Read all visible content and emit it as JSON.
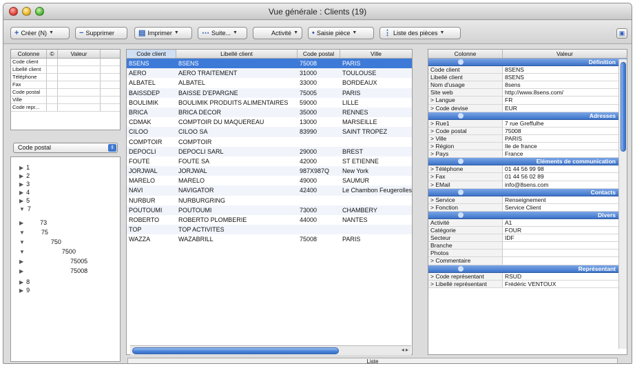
{
  "window": {
    "title": "Vue générale : Clients  (19)"
  },
  "toolbar": {
    "create": "Créer (N)",
    "delete": "Supprimer",
    "print": "Imprimer",
    "more": "Suite...",
    "activity": "Activité",
    "entry": "Saisie pièce",
    "list": "Liste des pièces"
  },
  "field_list": {
    "headers": [
      "Colonne",
      "©",
      "Valeur"
    ],
    "rows": [
      "Code client",
      "Libellé client",
      "Téléphone",
      "Fax",
      "Code postal",
      "Ville",
      "Code repr..."
    ]
  },
  "group_select": {
    "value": "Code postal"
  },
  "tree": [
    "1",
    "2",
    "3",
    "4",
    "5",
    "7",
    "73",
    "75",
    "750",
    "7500",
    "75005",
    "75008",
    "8",
    "9"
  ],
  "clients": {
    "headers": [
      "Code client",
      "Libellé client",
      "Code postal",
      "Ville"
    ],
    "rows": [
      [
        "8SENS",
        "8SENS",
        "75008",
        "PARIS"
      ],
      [
        "AERO",
        "AERO TRAITEMENT",
        "31000",
        "TOULOUSE"
      ],
      [
        "ALBATEL",
        "ALBATEL",
        "33000",
        "BORDEAUX"
      ],
      [
        "BAISSDEP",
        "BAISSE D'EPARGNE",
        "75005",
        "PARIS"
      ],
      [
        "BOULIMIK",
        "BOULIMIK PRODUITS ALIMENTAIRES",
        "59000",
        "LILLE"
      ],
      [
        "BRICA",
        "BRICA DECOR",
        "35000",
        "RENNES"
      ],
      [
        "CDMAK",
        "COMPTOIR DU MAQUEREAU",
        "13000",
        "MARSEILLE"
      ],
      [
        "CILOO",
        "CILOO SA",
        "83990",
        "SAINT TROPEZ"
      ],
      [
        "COMPTOIR",
        "COMPTOIR",
        "",
        ""
      ],
      [
        "DEPOCLI",
        "DEPOCLI SARL",
        "29000",
        "BREST"
      ],
      [
        "FOUTE",
        "FOUTE SA",
        "42000",
        "ST ETIENNE"
      ],
      [
        "JORJWAL",
        "JORJWAL",
        "987X987Q",
        "New York"
      ],
      [
        "MARELO",
        "MARELO",
        "49000",
        "SAUMUR"
      ],
      [
        "NAVI",
        "NAVIGATOR",
        "42400",
        "Le Chambon Feugerolles"
      ],
      [
        "NURBUR",
        "NURBURGRING",
        "",
        ""
      ],
      [
        "POUTOUMI",
        "POUTOUMI",
        "73000",
        "CHAMBERY"
      ],
      [
        "ROBERTO",
        "ROBERTO PLOMBERIE",
        "44000",
        "NANTES"
      ],
      [
        "TOP",
        "TOP ACTIVITES",
        "",
        ""
      ],
      [
        "WAZZA",
        "WAZABRILL",
        "75008",
        "PARIS"
      ]
    ]
  },
  "status": {
    "label": "Liste"
  },
  "details": {
    "headers": [
      "Colonne",
      "Valeur"
    ],
    "rows": [
      {
        "type": "section",
        "label": "Définition"
      },
      {
        "type": "field",
        "name": "Code client",
        "value": "8SENS"
      },
      {
        "type": "field",
        "name": "Libellé client",
        "value": "8SENS"
      },
      {
        "type": "field",
        "name": "Nom d'usage",
        "value": "8sens"
      },
      {
        "type": "field",
        "name": "Site web",
        "value": "http://www.8sens.com/"
      },
      {
        "type": "field",
        "name": "> Langue",
        "value": "FR"
      },
      {
        "type": "field",
        "name": "> Code devise",
        "value": "EUR"
      },
      {
        "type": "section",
        "label": "Adresses"
      },
      {
        "type": "field",
        "name": "> Rue1",
        "value": "7 rue Greffulhe"
      },
      {
        "type": "field",
        "name": "> Code postal",
        "value": "75008"
      },
      {
        "type": "field",
        "name": "> Ville",
        "value": "PARIS"
      },
      {
        "type": "field",
        "name": "> Région",
        "value": "Ile de france"
      },
      {
        "type": "field",
        "name": "> Pays",
        "value": "France"
      },
      {
        "type": "section",
        "label": "Eléments de communication"
      },
      {
        "type": "field",
        "name": "> Téléphone",
        "value": "01 44 56 99 98"
      },
      {
        "type": "field",
        "name": "> Fax",
        "value": "01 44 56 02 89"
      },
      {
        "type": "field",
        "name": "> EMail",
        "value": "info@8sens.com"
      },
      {
        "type": "section",
        "label": "Contacts"
      },
      {
        "type": "field",
        "name": "> Service",
        "value": "Renseignement"
      },
      {
        "type": "field",
        "name": "> Fonction",
        "value": "Service Client"
      },
      {
        "type": "section",
        "label": "Divers"
      },
      {
        "type": "field",
        "name": "Activité",
        "value": "A1"
      },
      {
        "type": "field",
        "name": "Catégorie",
        "value": "FOUR"
      },
      {
        "type": "field",
        "name": "Secteur",
        "value": "IDF"
      },
      {
        "type": "field",
        "name": "Branche",
        "value": ""
      },
      {
        "type": "field",
        "name": "Photos",
        "value": ""
      },
      {
        "type": "field",
        "name": "> Commentaire",
        "value": ""
      },
      {
        "type": "section",
        "label": "Représentant"
      },
      {
        "type": "field",
        "name": "> Code représentant",
        "value": "RSUD"
      },
      {
        "type": "field",
        "name": "> Libellé représentant",
        "value": "Frédéric VENTOUX"
      }
    ]
  }
}
